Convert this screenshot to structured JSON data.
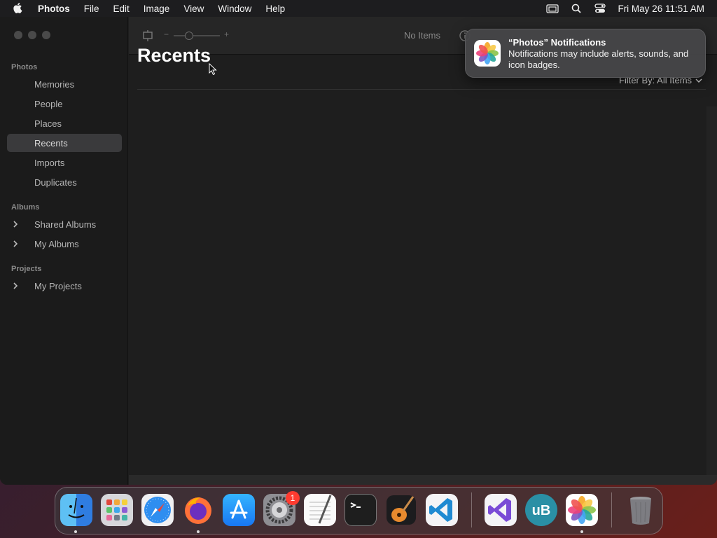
{
  "menubar": {
    "app_name": "Photos",
    "items": [
      "File",
      "Edit",
      "Image",
      "View",
      "Window",
      "Help"
    ],
    "clock": "Fri May 26  11:51 AM",
    "status_icons": [
      "screen-mirroring-icon",
      "spotlight-search-icon",
      "control-center-icon"
    ]
  },
  "toolbar": {
    "status": "No Items",
    "zoom_minus": "−",
    "zoom_plus": "+"
  },
  "sidebar": {
    "sections": [
      {
        "title": "Photos",
        "items": [
          "Memories",
          "People",
          "Places",
          "Recents",
          "Imports",
          "Duplicates"
        ]
      },
      {
        "title": "Albums",
        "items": [
          "Shared Albums",
          "My Albums"
        ]
      },
      {
        "title": "Projects",
        "items": [
          "My Projects"
        ]
      }
    ],
    "selected": "Recents"
  },
  "main": {
    "title": "Recents",
    "filter_label": "Filter By: All Items"
  },
  "notification": {
    "title": "“Photos” Notifications",
    "body": "Notifications may include alerts, sounds, and icon badges."
  },
  "dock": {
    "settings_badge": "1",
    "apps": [
      "finder",
      "launchpad",
      "safari",
      "firefox",
      "app-store",
      "system-settings",
      "textedit",
      "terminal",
      "garageband",
      "vscode",
      "visual-studio",
      "ublock",
      "photos",
      "trash"
    ]
  },
  "colors": {
    "accent_selected": "#3a3a3c",
    "badge": "#ff3b30",
    "window_bg": "#1e1e1e"
  }
}
